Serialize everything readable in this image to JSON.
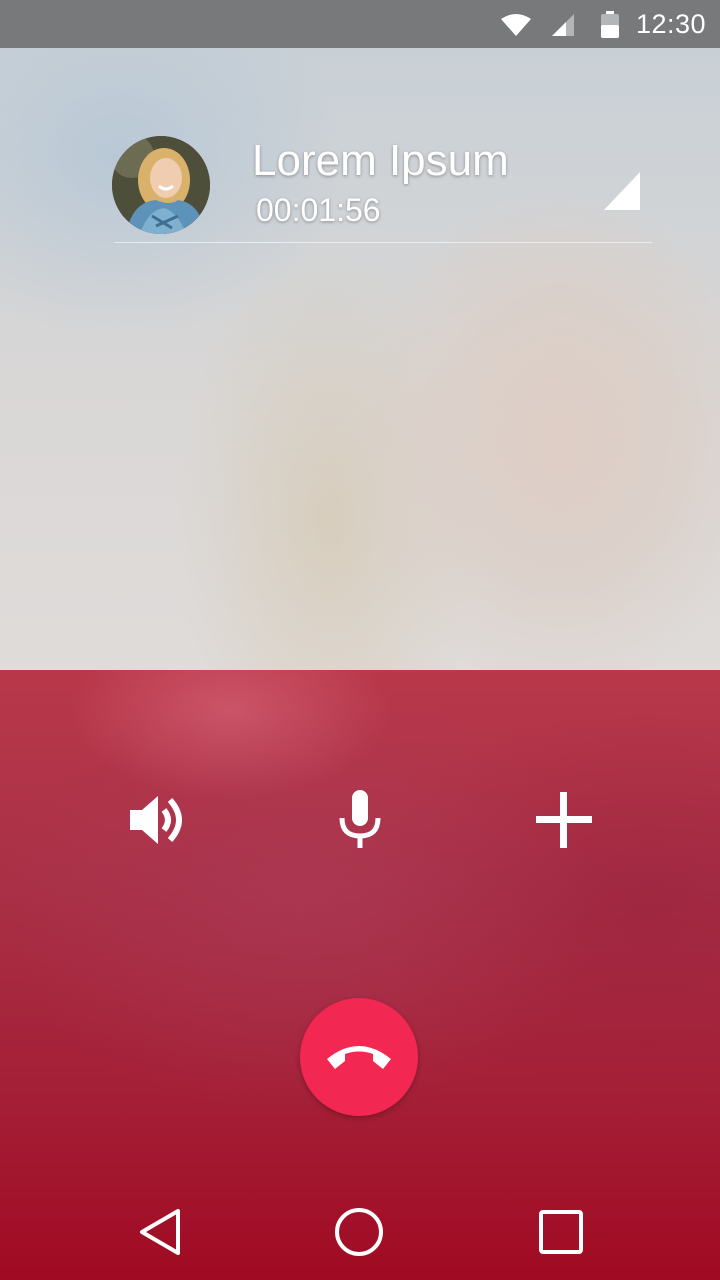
{
  "status_bar": {
    "time": "12:30",
    "icons": [
      "wifi-icon",
      "cell-signal-icon",
      "battery-icon"
    ]
  },
  "call": {
    "caller_name": "Lorem Ipsum",
    "duration": "00:01:56",
    "avatar": "caller-avatar-photo"
  },
  "controls": {
    "speaker_icon": "speaker-icon",
    "mute_icon": "microphone-icon",
    "add_call_icon": "plus-icon",
    "end_call_icon": "hang-up-phone-icon"
  },
  "nav": {
    "back_icon": "back-triangle-icon",
    "home_icon": "home-circle-icon",
    "recents_icon": "recents-square-icon"
  },
  "colors": {
    "status_bar": "#77797a",
    "panel_red": "#a93046",
    "end_call": "#f22752",
    "text": "#ffffff"
  }
}
